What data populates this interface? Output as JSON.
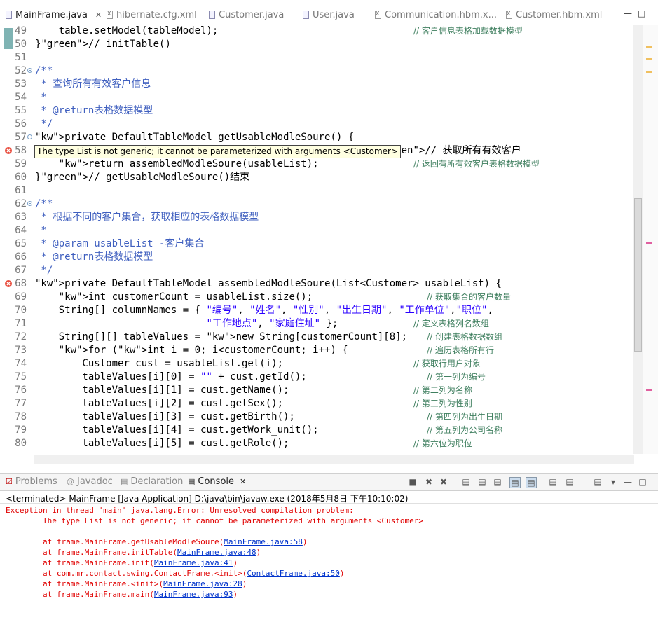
{
  "tabs": [
    {
      "label": "MainFrame.java",
      "active": true
    },
    {
      "label": "hibernate.cfg.xml"
    },
    {
      "label": "Customer.java"
    },
    {
      "label": "User.java"
    },
    {
      "label": "Communication.hbm.x..."
    },
    {
      "label": "Customer.hbm.xml"
    }
  ],
  "tab_close": "✕",
  "editor": {
    "lines": [
      {
        "n": "49",
        "code": "    table.setModel(tableModel);",
        "comment": "// 客户信息表格加载数据模型"
      },
      {
        "n": "50",
        "code": "}// initTable()",
        "comment": ""
      },
      {
        "n": "51",
        "code": "",
        "comment": ""
      },
      {
        "n": "52",
        "code": "/**",
        "comment": ""
      },
      {
        "n": "53",
        "code": " * 查询所有有效客户信息",
        "comment": ""
      },
      {
        "n": "54",
        "code": " *",
        "comment": ""
      },
      {
        "n": "55",
        "code": " * @return表格数据模型",
        "comment": ""
      },
      {
        "n": "56",
        "code": " */",
        "comment": ""
      },
      {
        "n": "57",
        "code": "private DefaultTableModel getUsableModleSoure() {",
        "comment": ""
      },
      {
        "n": "58",
        "code": "                                                 tomer(); // 获取所有有效客户",
        "comment": ""
      },
      {
        "n": "59",
        "code": "    return assembledModleSoure(usableList);",
        "comment": "// 返回有所有效客户表格数据模型"
      },
      {
        "n": "60",
        "code": "}// getUsableModleSoure()结束",
        "comment": ""
      },
      {
        "n": "61",
        "code": "",
        "comment": ""
      },
      {
        "n": "62",
        "code": "/**",
        "comment": ""
      },
      {
        "n": "63",
        "code": " * 根据不同的客户集合，获取相应的表格数据模型",
        "comment": ""
      },
      {
        "n": "64",
        "code": " *",
        "comment": ""
      },
      {
        "n": "65",
        "code": " * @param usableList -客户集合",
        "comment": ""
      },
      {
        "n": "66",
        "code": " * @return表格数据模型",
        "comment": ""
      },
      {
        "n": "67",
        "code": " */",
        "comment": ""
      },
      {
        "n": "68",
        "code": "private DefaultTableModel assembledModleSoure(List<Customer> usableList) {",
        "comment": ""
      },
      {
        "n": "69",
        "code": "    int customerCount = usableList.size();",
        "comment": "     // 获取集合的客户数量"
      },
      {
        "n": "70",
        "code": "    String[] columnNames = { \"编号\", \"姓名\", \"性别\", \"出生日期\", \"工作单位\",\"职位\",",
        "comment": ""
      },
      {
        "n": "71",
        "code": "                             \"工作地点\", \"家庭住址\" };",
        "comment": "// 定义表格列名数组"
      },
      {
        "n": "72",
        "code": "    String[][] tableValues = new String[customerCount][8];",
        "comment": "     // 创建表格数据数组"
      },
      {
        "n": "73",
        "code": "    for (int i = 0; i<customerCount; i++) {",
        "comment": "     // 遍历表格所有行"
      },
      {
        "n": "74",
        "code": "        Customer cust = usableList.get(i);",
        "comment": "// 获取行用户对象"
      },
      {
        "n": "75",
        "code": "        tableValues[i][0] = \"\" + cust.getId();",
        "comment": "     // 第一列为编号"
      },
      {
        "n": "76",
        "code": "        tableValues[i][1] = cust.getName();",
        "comment": "// 第二列为名称"
      },
      {
        "n": "77",
        "code": "        tableValues[i][2] = cust.getSex();",
        "comment": "// 第三列为性别"
      },
      {
        "n": "78",
        "code": "        tableValues[i][3] = cust.getBirth();",
        "comment": "     // 第四列为出生日期"
      },
      {
        "n": "79",
        "code": "        tableValues[i][4] = cust.getWork_unit();",
        "comment": "     // 第五列为公司名称"
      },
      {
        "n": "80",
        "code": "        tableValues[i][5] = cust.getRole();",
        "comment": "// 第六位为职位"
      }
    ],
    "tooltip": "The type List is not generic; it cannot be parameterized with arguments <Customer>"
  },
  "bottom_panel": {
    "tabs": [
      {
        "label": "Problems"
      },
      {
        "label": "Javadoc"
      },
      {
        "label": "Declaration"
      },
      {
        "label": "Console",
        "active": true
      }
    ],
    "status": "<terminated> MainFrame [Java Application] D:\\java\\bin\\javaw.exe (2018年5月8日 下午10:10:02)",
    "console_lines": [
      {
        "text": "Exception in thread \"main\" java.lang.Error: Unresolved compilation problem: "
      },
      {
        "text": "\tThe type List is not generic; it cannot be parameterized with arguments <Customer>"
      },
      {
        "text": ""
      },
      {
        "pre": "\tat frame.MainFrame.getUsableModleSoure(",
        "link": "MainFrame.java:58",
        "post": ")"
      },
      {
        "pre": "\tat frame.MainFrame.initTable(",
        "link": "MainFrame.java:48",
        "post": ")"
      },
      {
        "pre": "\tat frame.MainFrame.init(",
        "link": "MainFrame.java:41",
        "post": ")"
      },
      {
        "pre": "\tat com.mr.contact.swing.ContactFrame.<init>(",
        "link": "ContactFrame.java:50",
        "post": ")"
      },
      {
        "pre": "\tat frame.MainFrame.<init>(",
        "link": "MainFrame.java:28",
        "post": ")"
      },
      {
        "pre": "\tat frame.MainFrame.main(",
        "link": "MainFrame.java:93",
        "post": ")"
      }
    ]
  },
  "colors": {
    "keyword": "#7f0055",
    "comment": "#3f7f5f",
    "javadoc": "#3f5fbf",
    "error": "#e00000",
    "link": "#0033cc"
  }
}
